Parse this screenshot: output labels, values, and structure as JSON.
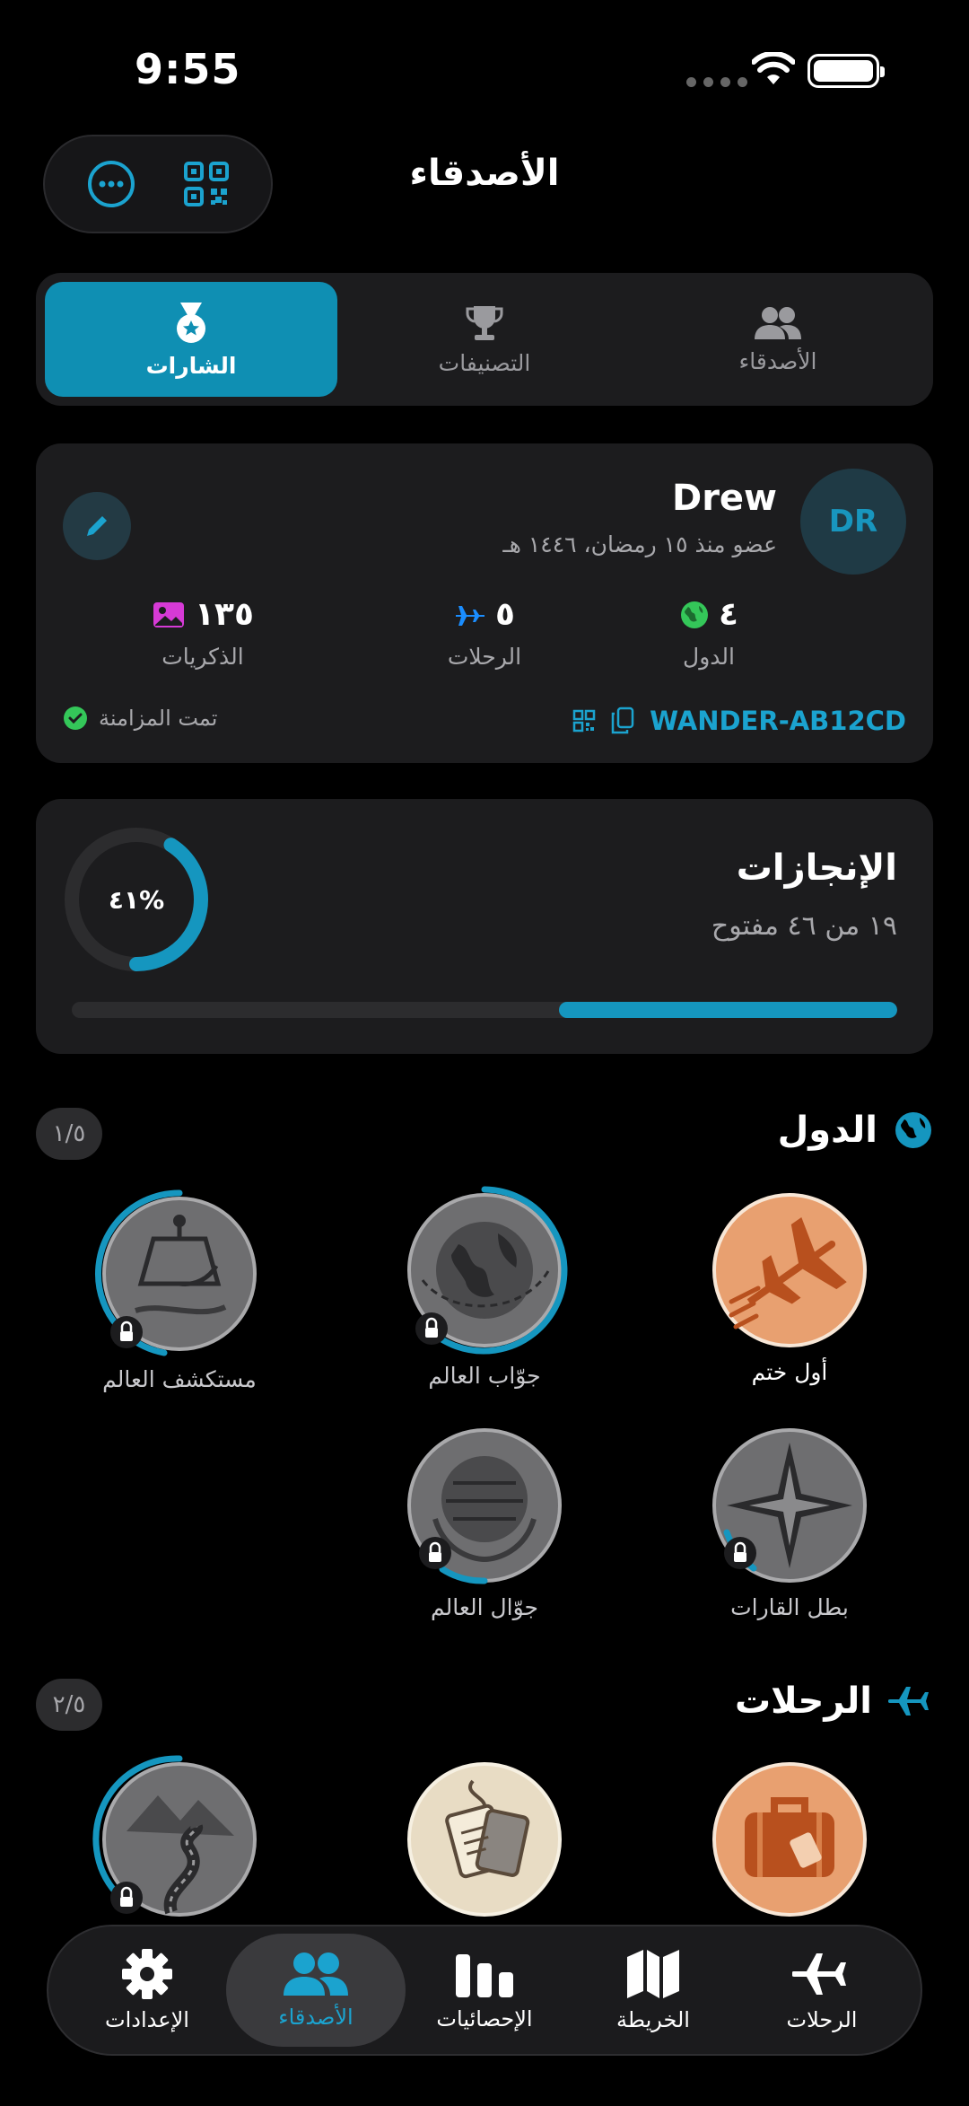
{
  "status_bar": {
    "time": "9:55"
  },
  "header": {
    "title": "الأصدقاء"
  },
  "segments": [
    {
      "label": "الأصدقاء",
      "icon": "people-icon"
    },
    {
      "label": "التصنيفات",
      "icon": "trophy-icon"
    },
    {
      "label": "الشارات",
      "icon": "medal-icon",
      "active": true
    }
  ],
  "profile": {
    "initials": "DR",
    "name": "Drew",
    "member_since": "عضو منذ ١٥ رمضان، ١٤٤٦ هـ",
    "stats": [
      {
        "value": "٤",
        "label": "الدول",
        "icon": "globe-icon"
      },
      {
        "value": "٥",
        "label": "الرحلات",
        "icon": "plane-icon"
      },
      {
        "value": "١٣٥",
        "label": "الذكريات",
        "icon": "photo-icon"
      }
    ],
    "invite_code": "WANDER-AB12CD",
    "sync_status": "تمت المزامنة"
  },
  "achievements": {
    "title": "الإنجازات",
    "subtitle": "١٩ من ٤٦ مفتوح",
    "percent_label": "٤١%",
    "progress": 0.41
  },
  "sections": [
    {
      "title": "الدول",
      "count": "١/٥",
      "badges": [
        {
          "label": "أول ختم",
          "locked": false
        },
        {
          "label": "جوّاب العالم",
          "locked": true
        },
        {
          "label": "مستكشف العالم",
          "locked": true
        },
        {
          "label": "بطل القارات",
          "locked": true
        },
        {
          "label": "جوّال العالم",
          "locked": true
        }
      ]
    },
    {
      "title": "الرحلات",
      "count": "٢/٥",
      "badges": [
        {
          "label": "حقيبة السفر",
          "locked": false
        },
        {
          "label": "البطاقات",
          "locked": false
        },
        {
          "label": "الطريق",
          "locked": true
        }
      ]
    }
  ],
  "colors": {
    "accent": "#1596bf",
    "card": "#1c1c1e",
    "badge_orange": "#e8a070"
  },
  "tabbar": [
    {
      "label": "الإعدادات",
      "icon": "gear-icon"
    },
    {
      "label": "الأصدقاء",
      "icon": "people-icon",
      "active": true
    },
    {
      "label": "الإحصائيات",
      "icon": "stats-icon"
    },
    {
      "label": "الخريطة",
      "icon": "map-icon"
    },
    {
      "label": "الرحلات",
      "icon": "plane-icon"
    }
  ]
}
